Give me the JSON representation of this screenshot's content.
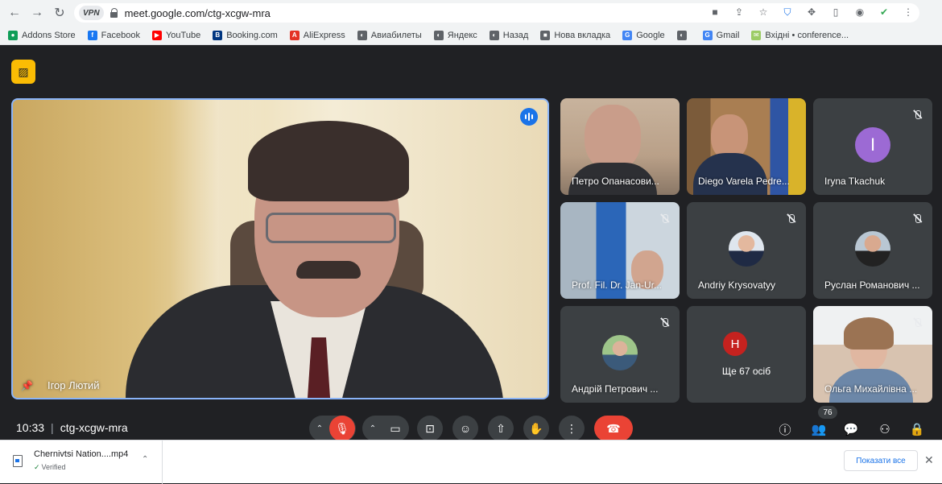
{
  "browser": {
    "url": "meet.google.com/ctg-xcgw-mra",
    "vpn_label": "VPN",
    "bookmarks": [
      {
        "label": "Addons Store",
        "color": "#0f9d58",
        "glyph": "●"
      },
      {
        "label": "Facebook",
        "color": "#1877f2",
        "glyph": "f"
      },
      {
        "label": "YouTube",
        "color": "#ff0000",
        "glyph": "▶"
      },
      {
        "label": "Booking.com",
        "color": "#003580",
        "glyph": "B"
      },
      {
        "label": "AliExpress",
        "color": "#e43225",
        "glyph": "A"
      },
      {
        "label": "Авиабилеты",
        "color": "#5f6368",
        "glyph": "◐"
      },
      {
        "label": "Яндекс",
        "color": "#5f6368",
        "glyph": "◐"
      },
      {
        "label": "Назад",
        "color": "#5f6368",
        "glyph": "◐"
      },
      {
        "label": "Нова вкладка",
        "color": "#5f6368",
        "glyph": "■"
      },
      {
        "label": "Google",
        "color": "#4285f4",
        "glyph": "G"
      },
      {
        "label": "",
        "color": "#5f6368",
        "glyph": "◐"
      },
      {
        "label": "Gmail",
        "color": "#4285f4",
        "glyph": "G"
      },
      {
        "label": "Вхідні • conference...",
        "color": "#9ccc65",
        "glyph": "✉"
      }
    ]
  },
  "meet": {
    "main_speaker": "Ігор Лютий",
    "tiles": [
      {
        "name": "Петро Опанасови...",
        "muted": false
      },
      {
        "name": "Diego Varela Pedre...",
        "muted": false
      },
      {
        "name": "Iryna Tkachuk",
        "muted": true,
        "initial": "I",
        "avatar_color": "#9c6ad4"
      },
      {
        "name": "Prof. Fil. Dr. Jan-Ur...",
        "muted": true
      },
      {
        "name": "Andriy Krysovatyy",
        "muted": true
      },
      {
        "name": "Руслан Романович ...",
        "muted": true
      },
      {
        "name": "Андрій Петрович ...",
        "muted": true
      },
      {
        "name": "Ще 67 осіб",
        "muted": false,
        "initial": "H",
        "avatar_color": "#c5221f"
      },
      {
        "name": "Ольга Михайлівна ...",
        "muted": true
      }
    ],
    "time": "10:33",
    "meeting_code": "ctg-xcgw-mra",
    "participants_count": "76"
  },
  "downloads": {
    "file_name": "Chernivtsi Nation....mp4",
    "status": "Verified",
    "show_all_label": "Показати все"
  }
}
